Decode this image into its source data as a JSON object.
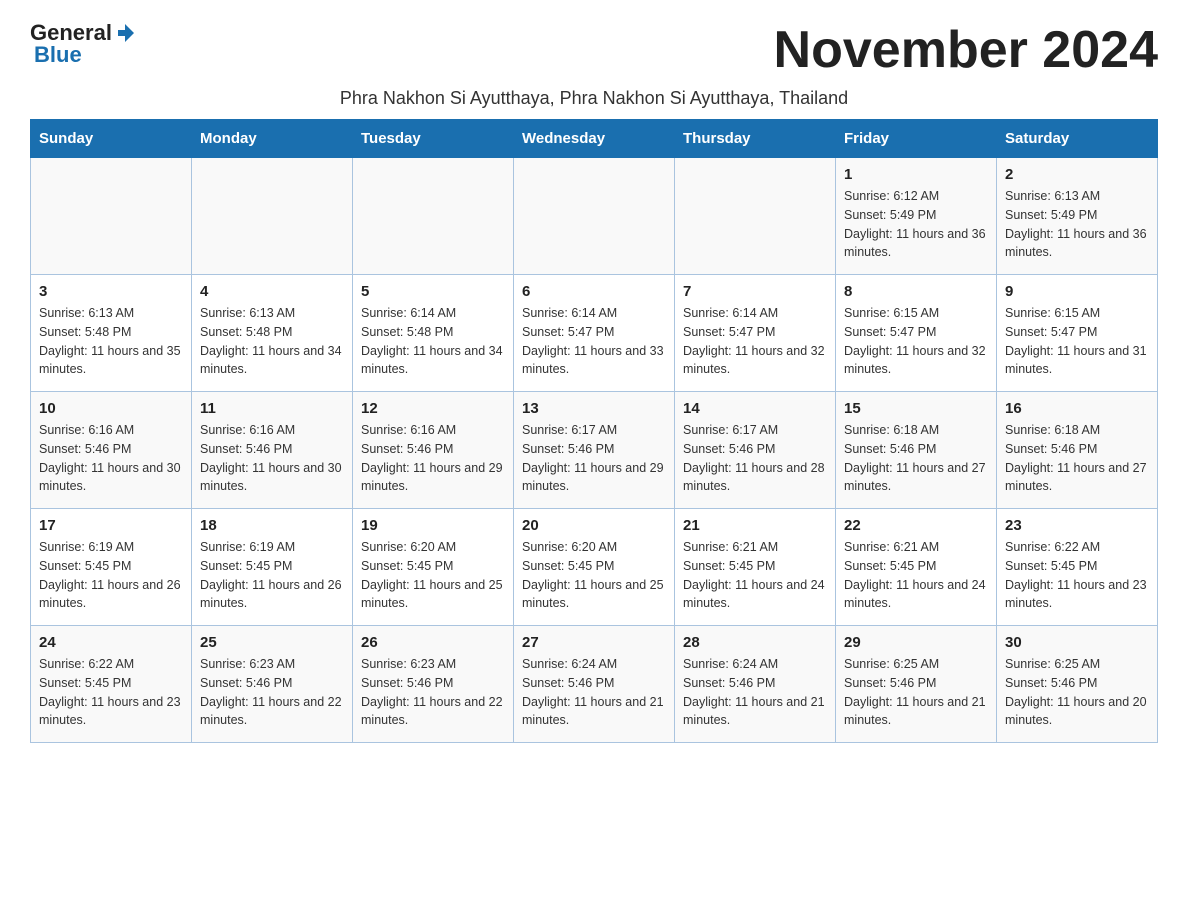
{
  "header": {
    "logo_general": "General",
    "logo_blue": "Blue",
    "month_title": "November 2024",
    "subtitle": "Phra Nakhon Si Ayutthaya, Phra Nakhon Si Ayutthaya, Thailand"
  },
  "columns": [
    "Sunday",
    "Monday",
    "Tuesday",
    "Wednesday",
    "Thursday",
    "Friday",
    "Saturday"
  ],
  "rows": [
    [
      {
        "day": "",
        "info": ""
      },
      {
        "day": "",
        "info": ""
      },
      {
        "day": "",
        "info": ""
      },
      {
        "day": "",
        "info": ""
      },
      {
        "day": "",
        "info": ""
      },
      {
        "day": "1",
        "info": "Sunrise: 6:12 AM\nSunset: 5:49 PM\nDaylight: 11 hours and 36 minutes."
      },
      {
        "day": "2",
        "info": "Sunrise: 6:13 AM\nSunset: 5:49 PM\nDaylight: 11 hours and 36 minutes."
      }
    ],
    [
      {
        "day": "3",
        "info": "Sunrise: 6:13 AM\nSunset: 5:48 PM\nDaylight: 11 hours and 35 minutes."
      },
      {
        "day": "4",
        "info": "Sunrise: 6:13 AM\nSunset: 5:48 PM\nDaylight: 11 hours and 34 minutes."
      },
      {
        "day": "5",
        "info": "Sunrise: 6:14 AM\nSunset: 5:48 PM\nDaylight: 11 hours and 34 minutes."
      },
      {
        "day": "6",
        "info": "Sunrise: 6:14 AM\nSunset: 5:47 PM\nDaylight: 11 hours and 33 minutes."
      },
      {
        "day": "7",
        "info": "Sunrise: 6:14 AM\nSunset: 5:47 PM\nDaylight: 11 hours and 32 minutes."
      },
      {
        "day": "8",
        "info": "Sunrise: 6:15 AM\nSunset: 5:47 PM\nDaylight: 11 hours and 32 minutes."
      },
      {
        "day": "9",
        "info": "Sunrise: 6:15 AM\nSunset: 5:47 PM\nDaylight: 11 hours and 31 minutes."
      }
    ],
    [
      {
        "day": "10",
        "info": "Sunrise: 6:16 AM\nSunset: 5:46 PM\nDaylight: 11 hours and 30 minutes."
      },
      {
        "day": "11",
        "info": "Sunrise: 6:16 AM\nSunset: 5:46 PM\nDaylight: 11 hours and 30 minutes."
      },
      {
        "day": "12",
        "info": "Sunrise: 6:16 AM\nSunset: 5:46 PM\nDaylight: 11 hours and 29 minutes."
      },
      {
        "day": "13",
        "info": "Sunrise: 6:17 AM\nSunset: 5:46 PM\nDaylight: 11 hours and 29 minutes."
      },
      {
        "day": "14",
        "info": "Sunrise: 6:17 AM\nSunset: 5:46 PM\nDaylight: 11 hours and 28 minutes."
      },
      {
        "day": "15",
        "info": "Sunrise: 6:18 AM\nSunset: 5:46 PM\nDaylight: 11 hours and 27 minutes."
      },
      {
        "day": "16",
        "info": "Sunrise: 6:18 AM\nSunset: 5:46 PM\nDaylight: 11 hours and 27 minutes."
      }
    ],
    [
      {
        "day": "17",
        "info": "Sunrise: 6:19 AM\nSunset: 5:45 PM\nDaylight: 11 hours and 26 minutes."
      },
      {
        "day": "18",
        "info": "Sunrise: 6:19 AM\nSunset: 5:45 PM\nDaylight: 11 hours and 26 minutes."
      },
      {
        "day": "19",
        "info": "Sunrise: 6:20 AM\nSunset: 5:45 PM\nDaylight: 11 hours and 25 minutes."
      },
      {
        "day": "20",
        "info": "Sunrise: 6:20 AM\nSunset: 5:45 PM\nDaylight: 11 hours and 25 minutes."
      },
      {
        "day": "21",
        "info": "Sunrise: 6:21 AM\nSunset: 5:45 PM\nDaylight: 11 hours and 24 minutes."
      },
      {
        "day": "22",
        "info": "Sunrise: 6:21 AM\nSunset: 5:45 PM\nDaylight: 11 hours and 24 minutes."
      },
      {
        "day": "23",
        "info": "Sunrise: 6:22 AM\nSunset: 5:45 PM\nDaylight: 11 hours and 23 minutes."
      }
    ],
    [
      {
        "day": "24",
        "info": "Sunrise: 6:22 AM\nSunset: 5:45 PM\nDaylight: 11 hours and 23 minutes."
      },
      {
        "day": "25",
        "info": "Sunrise: 6:23 AM\nSunset: 5:46 PM\nDaylight: 11 hours and 22 minutes."
      },
      {
        "day": "26",
        "info": "Sunrise: 6:23 AM\nSunset: 5:46 PM\nDaylight: 11 hours and 22 minutes."
      },
      {
        "day": "27",
        "info": "Sunrise: 6:24 AM\nSunset: 5:46 PM\nDaylight: 11 hours and 21 minutes."
      },
      {
        "day": "28",
        "info": "Sunrise: 6:24 AM\nSunset: 5:46 PM\nDaylight: 11 hours and 21 minutes."
      },
      {
        "day": "29",
        "info": "Sunrise: 6:25 AM\nSunset: 5:46 PM\nDaylight: 11 hours and 21 minutes."
      },
      {
        "day": "30",
        "info": "Sunrise: 6:25 AM\nSunset: 5:46 PM\nDaylight: 11 hours and 20 minutes."
      }
    ]
  ]
}
